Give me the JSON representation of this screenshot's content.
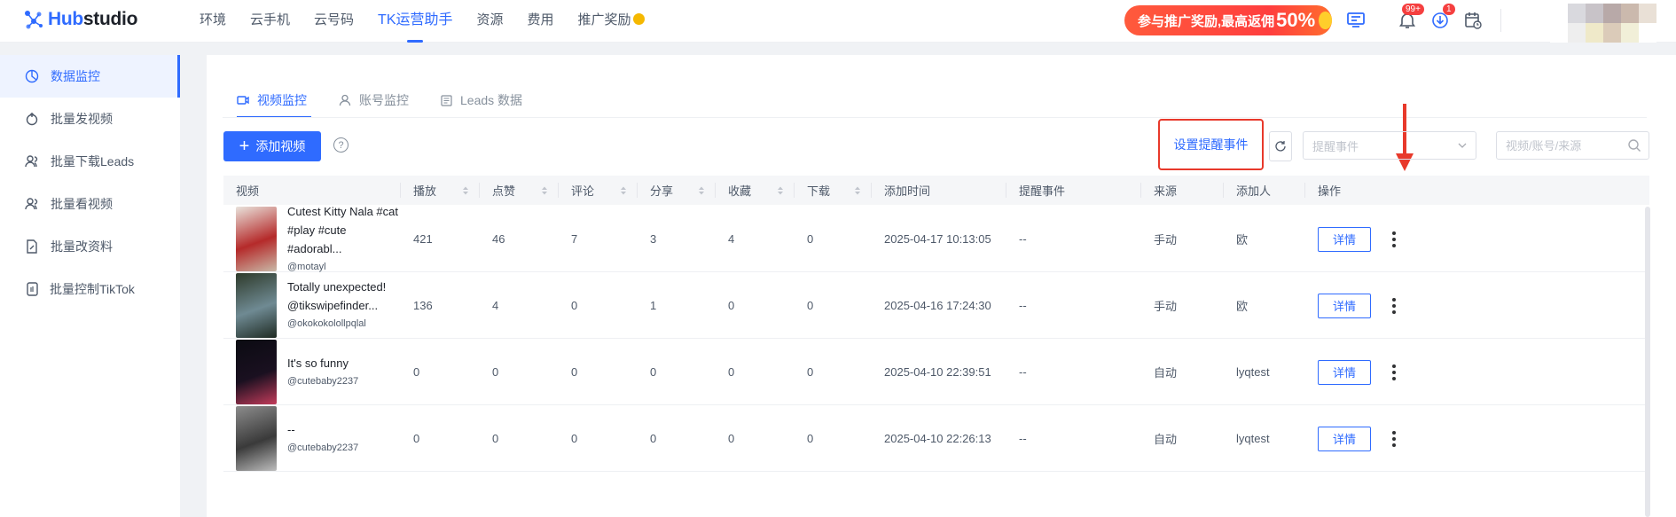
{
  "app": {
    "logo_hub": "Hub",
    "logo_studio": "studio",
    "nav": [
      {
        "label": "环境"
      },
      {
        "label": "云手机"
      },
      {
        "label": "云号码"
      },
      {
        "label": "TK运营助手",
        "active": true
      },
      {
        "label": "资源"
      },
      {
        "label": "费用"
      },
      {
        "label": "推广奖励"
      }
    ],
    "promo_text": "参与推广奖励,最高返佣",
    "promo_percent": "50%",
    "notif_badge": "99+",
    "download_badge": "1"
  },
  "sidebar": {
    "items": [
      {
        "label": "数据监控",
        "icon": "chart-icon",
        "active": true
      },
      {
        "label": "批量发视频",
        "icon": "publish-icon"
      },
      {
        "label": "批量下载Leads",
        "icon": "users-icon"
      },
      {
        "label": "批量看视频",
        "icon": "users-icon"
      },
      {
        "label": "批量改资料",
        "icon": "file-edit-icon"
      },
      {
        "label": "批量控制TikTok",
        "icon": "phone-icon"
      }
    ]
  },
  "tabs": [
    {
      "label": "视频监控",
      "icon": "video-icon",
      "active": true
    },
    {
      "label": "账号监控",
      "icon": "user-icon"
    },
    {
      "label": "Leads 数据",
      "icon": "list-icon"
    }
  ],
  "toolbar": {
    "add_video": "添加视频",
    "help_glyph": "?",
    "set_reminder": "设置提醒事件",
    "reminder_select_placeholder": "提醒事件",
    "search_placeholder": "视频/账号/来源"
  },
  "table": {
    "columns": [
      "视频",
      "播放",
      "点赞",
      "评论",
      "分享",
      "收藏",
      "下载",
      "添加时间",
      "提醒事件",
      "来源",
      "添加人",
      "操作"
    ],
    "detail_label": "详情",
    "rows": [
      {
        "title_1": "Cutest Kitty Nala #cat",
        "title_2": "#play #cute #adorabl...",
        "handle": "@motayl",
        "play": "421",
        "like": "46",
        "comment": "7",
        "share": "3",
        "fav": "4",
        "download": "0",
        "added": "2025-04-17 10:13:05",
        "reminder": "--",
        "source": "手动",
        "adder": "欧",
        "thumb": [
          "#e9e3dc",
          "#b52a2a",
          "#c9b9a8"
        ]
      },
      {
        "title_1": "Totally unexpected!",
        "title_2": "@tikswipefinder...",
        "handle": "@okokokolollpqlal",
        "play": "136",
        "like": "4",
        "comment": "0",
        "share": "1",
        "fav": "0",
        "download": "0",
        "added": "2025-04-16 17:24:30",
        "reminder": "--",
        "source": "手动",
        "adder": "欧",
        "thumb": [
          "#2e3a2a",
          "#6f8a93",
          "#1e2a22"
        ]
      },
      {
        "title_1": "It's so funny",
        "title_2": "",
        "handle": "@cutebaby2237",
        "play": "0",
        "like": "0",
        "comment": "0",
        "share": "0",
        "fav": "0",
        "download": "0",
        "added": "2025-04-10 22:39:51",
        "reminder": "--",
        "source": "自动",
        "adder": "lyqtest",
        "thumb": [
          "#0b0b12",
          "#1a1020",
          "#c23b5a"
        ]
      },
      {
        "title_1": "--",
        "title_2": "",
        "handle": "@cutebaby2237",
        "play": "0",
        "like": "0",
        "comment": "0",
        "share": "0",
        "fav": "0",
        "download": "0",
        "added": "2025-04-10 22:26:13",
        "reminder": "--",
        "source": "自动",
        "adder": "lyqtest",
        "thumb": [
          "#8c8c8c",
          "#3a3a3a",
          "#bdbdbd"
        ]
      }
    ]
  },
  "colors": {
    "accent": "#2f6bff",
    "highlight_border": "#e8392b",
    "annotation_arrow": "#e8392b"
  }
}
